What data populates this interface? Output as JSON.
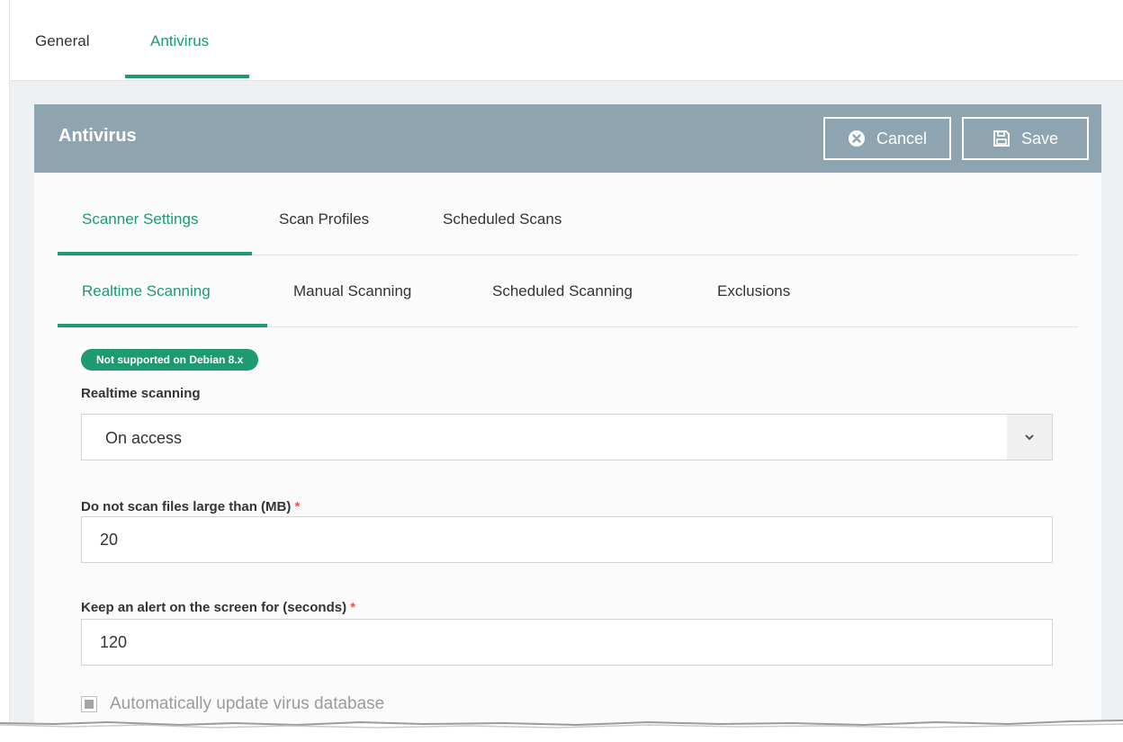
{
  "top_tabs": {
    "general": "General",
    "antivirus": "Antivirus"
  },
  "panel": {
    "title": "Antivirus",
    "cancel_label": "Cancel",
    "save_label": "Save"
  },
  "sub_tabs": [
    "Scanner Settings",
    "Scan Profiles",
    "Scheduled Scans"
  ],
  "scan_tabs": [
    "Realtime Scanning",
    "Manual Scanning",
    "Scheduled Scanning",
    "Exclusions"
  ],
  "form": {
    "badge": "Not supported on Debian 8.x",
    "realtime_label": "Realtime scanning",
    "realtime_value": "On access",
    "max_size_label": "Do not scan files large than (MB)",
    "max_size_value": "20",
    "alert_label": "Keep an alert on the screen for (seconds)",
    "alert_value": "120",
    "required_mark": "*",
    "auto_update_label": "Automatically update virus database"
  },
  "colors": {
    "accent": "#1e9a6f",
    "header": "#8ea4b1",
    "required": "#e25b4e"
  }
}
